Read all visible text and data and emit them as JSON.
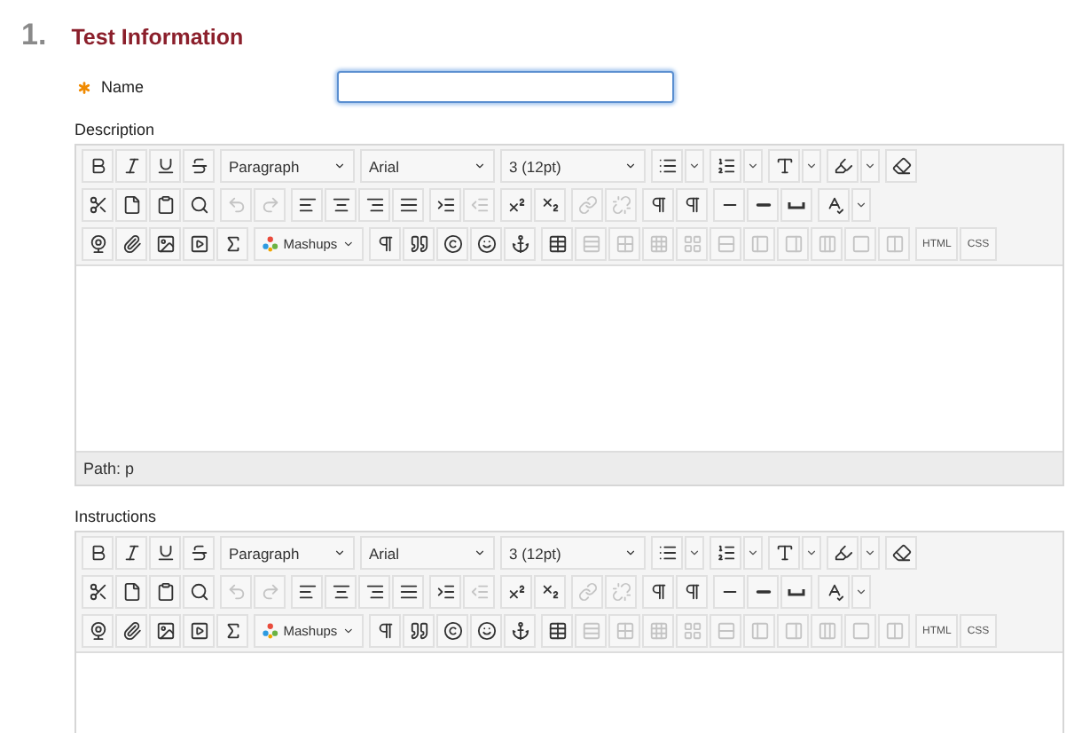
{
  "section": {
    "number": "1.",
    "title": "Test Information"
  },
  "name_field": {
    "label": "Name",
    "required": true,
    "focused": true
  },
  "editors": [
    {
      "label": "Description",
      "path": "Path: p",
      "toolbar": [
        [
          [
            {
              "kind": "icon",
              "disabled": false
            },
            {
              "kind": "icon",
              "disabled": false
            },
            {
              "kind": "icon",
              "disabled": false
            },
            {
              "kind": "icon",
              "disabled": false
            }
          ],
          [
            {
              "kind": "select",
              "label": "Paragraph"
            }
          ],
          [
            {
              "kind": "select",
              "label": "Arial"
            }
          ],
          [
            {
              "kind": "select",
              "label": "3 (12pt)"
            }
          ],
          [
            {
              "kind": "icon",
              "disabled": false,
              "menu": true
            }
          ],
          [
            {
              "kind": "icon",
              "disabled": false,
              "menu": true
            }
          ],
          [
            {
              "kind": "icon",
              "disabled": false,
              "menu": true
            }
          ],
          [
            {
              "kind": "icon",
              "disabled": false,
              "menu": true
            }
          ],
          [
            {
              "kind": "icon",
              "disabled": false
            }
          ]
        ],
        [
          [
            {
              "kind": "icon",
              "disabled": false
            },
            {
              "kind": "icon",
              "disabled": false
            },
            {
              "kind": "icon",
              "disabled": false
            },
            {
              "kind": "icon",
              "disabled": false
            }
          ],
          [
            {
              "kind": "icon",
              "disabled": true
            },
            {
              "kind": "icon",
              "disabled": true
            }
          ],
          [
            {
              "kind": "icon",
              "disabled": false
            },
            {
              "kind": "icon",
              "disabled": false
            },
            {
              "kind": "icon",
              "disabled": false
            },
            {
              "kind": "icon",
              "disabled": false
            }
          ],
          [
            {
              "kind": "icon",
              "disabled": false
            },
            {
              "kind": "icon",
              "disabled": true
            }
          ],
          [
            {
              "kind": "icon",
              "disabled": false
            },
            {
              "kind": "icon",
              "disabled": false
            }
          ],
          [
            {
              "kind": "icon",
              "disabled": true
            },
            {
              "kind": "icon",
              "disabled": true
            }
          ],
          [
            {
              "kind": "icon",
              "disabled": false
            },
            {
              "kind": "icon",
              "disabled": false
            }
          ],
          [
            {
              "kind": "icon",
              "disabled": false
            },
            {
              "kind": "icon",
              "disabled": false
            },
            {
              "kind": "icon",
              "disabled": false
            }
          ],
          [
            {
              "kind": "icon",
              "disabled": false,
              "menu": true
            }
          ]
        ],
        [
          [
            {
              "kind": "icon",
              "disabled": false
            },
            {
              "kind": "icon",
              "disabled": false
            },
            {
              "kind": "icon",
              "disabled": false
            },
            {
              "kind": "icon",
              "disabled": false
            },
            {
              "kind": "icon",
              "disabled": false
            }
          ],
          [
            {
              "kind": "menu",
              "label": "Mashups"
            }
          ],
          [
            {
              "kind": "icon",
              "disabled": false
            },
            {
              "kind": "icon",
              "disabled": false
            },
            {
              "kind": "icon",
              "disabled": false
            },
            {
              "kind": "icon",
              "disabled": false
            },
            {
              "kind": "icon",
              "disabled": false
            }
          ],
          [
            {
              "kind": "icon",
              "disabled": false
            },
            {
              "kind": "icon",
              "disabled": true
            },
            {
              "kind": "icon",
              "disabled": true
            },
            {
              "kind": "icon",
              "disabled": true
            },
            {
              "kind": "icon",
              "disabled": true
            },
            {
              "kind": "icon",
              "disabled": true
            },
            {
              "kind": "icon",
              "disabled": true
            },
            {
              "kind": "icon",
              "disabled": true
            },
            {
              "kind": "icon",
              "disabled": true
            },
            {
              "kind": "icon",
              "disabled": true
            },
            {
              "kind": "icon",
              "disabled": true
            }
          ],
          [
            {
              "kind": "text",
              "label": "HTML"
            },
            {
              "kind": "text",
              "label": "CSS"
            }
          ]
        ]
      ]
    },
    {
      "label": "Instructions",
      "toolbar": [
        [
          [
            {
              "kind": "icon",
              "disabled": false
            },
            {
              "kind": "icon",
              "disabled": false
            },
            {
              "kind": "icon",
              "disabled": false
            },
            {
              "kind": "icon",
              "disabled": false
            }
          ],
          [
            {
              "kind": "select",
              "label": "Paragraph"
            }
          ],
          [
            {
              "kind": "select",
              "label": "Arial"
            }
          ],
          [
            {
              "kind": "select",
              "label": "3 (12pt)"
            }
          ],
          [
            {
              "kind": "icon",
              "disabled": false,
              "menu": true
            }
          ],
          [
            {
              "kind": "icon",
              "disabled": false,
              "menu": true
            }
          ],
          [
            {
              "kind": "icon",
              "disabled": false,
              "menu": true
            }
          ],
          [
            {
              "kind": "icon",
              "disabled": false,
              "menu": true
            }
          ],
          [
            {
              "kind": "icon",
              "disabled": false
            }
          ]
        ],
        [
          [
            {
              "kind": "icon",
              "disabled": false
            },
            {
              "kind": "icon",
              "disabled": false
            },
            {
              "kind": "icon",
              "disabled": false
            },
            {
              "kind": "icon",
              "disabled": false
            }
          ],
          [
            {
              "kind": "icon",
              "disabled": true
            },
            {
              "kind": "icon",
              "disabled": true
            }
          ],
          [
            {
              "kind": "icon",
              "disabled": false
            },
            {
              "kind": "icon",
              "disabled": false
            },
            {
              "kind": "icon",
              "disabled": false
            },
            {
              "kind": "icon",
              "disabled": false
            }
          ],
          [
            {
              "kind": "icon",
              "disabled": false
            },
            {
              "kind": "icon",
              "disabled": true
            }
          ],
          [
            {
              "kind": "icon",
              "disabled": false
            },
            {
              "kind": "icon",
              "disabled": false
            }
          ],
          [
            {
              "kind": "icon",
              "disabled": true
            },
            {
              "kind": "icon",
              "disabled": true
            }
          ],
          [
            {
              "kind": "icon",
              "disabled": false
            },
            {
              "kind": "icon",
              "disabled": false
            }
          ],
          [
            {
              "kind": "icon",
              "disabled": false
            },
            {
              "kind": "icon",
              "disabled": false
            },
            {
              "kind": "icon",
              "disabled": false
            }
          ],
          [
            {
              "kind": "icon",
              "disabled": false,
              "menu": true
            }
          ]
        ],
        [
          [
            {
              "kind": "icon",
              "disabled": false
            },
            {
              "kind": "icon",
              "disabled": false
            },
            {
              "kind": "icon",
              "disabled": false
            },
            {
              "kind": "icon",
              "disabled": false
            },
            {
              "kind": "icon",
              "disabled": false
            }
          ],
          [
            {
              "kind": "menu",
              "label": "Mashups"
            }
          ],
          [
            {
              "kind": "icon",
              "disabled": false
            },
            {
              "kind": "icon",
              "disabled": false
            },
            {
              "kind": "icon",
              "disabled": false
            },
            {
              "kind": "icon",
              "disabled": false
            },
            {
              "kind": "icon",
              "disabled": false
            }
          ],
          [
            {
              "kind": "icon",
              "disabled": false
            },
            {
              "kind": "icon",
              "disabled": true
            },
            {
              "kind": "icon",
              "disabled": true
            },
            {
              "kind": "icon",
              "disabled": true
            },
            {
              "kind": "icon",
              "disabled": true
            },
            {
              "kind": "icon",
              "disabled": true
            },
            {
              "kind": "icon",
              "disabled": true
            },
            {
              "kind": "icon",
              "disabled": true
            },
            {
              "kind": "icon",
              "disabled": true
            },
            {
              "kind": "icon",
              "disabled": true
            },
            {
              "kind": "icon",
              "disabled": true
            }
          ],
          [
            {
              "kind": "text",
              "label": "HTML"
            },
            {
              "kind": "text",
              "label": "CSS"
            }
          ]
        ]
      ]
    }
  ]
}
